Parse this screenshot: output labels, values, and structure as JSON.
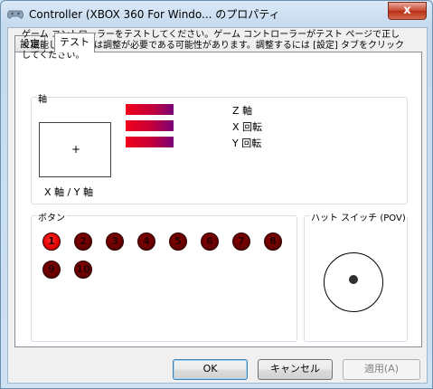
{
  "window": {
    "title": "Controller (XBOX 360 For Windo... のプロパティ",
    "close_label": "x"
  },
  "tabs": [
    {
      "label": "設定"
    },
    {
      "label": "テスト"
    }
  ],
  "intro_text": "ゲーム コントローラーをテストしてください。ゲーム コントローラーがテスト ページで正しく機能しない場合は調整が必要である可能性があります。調整するには [設定] タブをクリックしてください。",
  "axes_group": {
    "label": "軸",
    "xy_label": "X 軸 / Y 軸",
    "crosshair": "+",
    "axes": [
      {
        "label": "Z 軸"
      },
      {
        "label": "X 回転"
      },
      {
        "label": "Y 回転"
      }
    ]
  },
  "buttons_group": {
    "label": "ボタン",
    "buttons": [
      {
        "label": "1",
        "pressed": true
      },
      {
        "label": "2",
        "pressed": false
      },
      {
        "label": "3",
        "pressed": false
      },
      {
        "label": "4",
        "pressed": false
      },
      {
        "label": "5",
        "pressed": false
      },
      {
        "label": "6",
        "pressed": false
      },
      {
        "label": "7",
        "pressed": false
      },
      {
        "label": "8",
        "pressed": false
      },
      {
        "label": "9",
        "pressed": false
      },
      {
        "label": "10",
        "pressed": false
      }
    ]
  },
  "pov_group": {
    "label": "ハット スイッチ (POV)"
  },
  "dialog_buttons": {
    "ok": "OK",
    "cancel": "キャンセル",
    "apply": "適用(A)"
  },
  "icons": {
    "title_icon": "gamepad-icon",
    "close_icon": "close-icon"
  },
  "colors": {
    "axis_bar_start": "#f2001b",
    "axis_bar_end": "#7a0078",
    "button_off": "#6a0000",
    "button_on": "#e00000",
    "window_frame": "#c9dff2"
  }
}
